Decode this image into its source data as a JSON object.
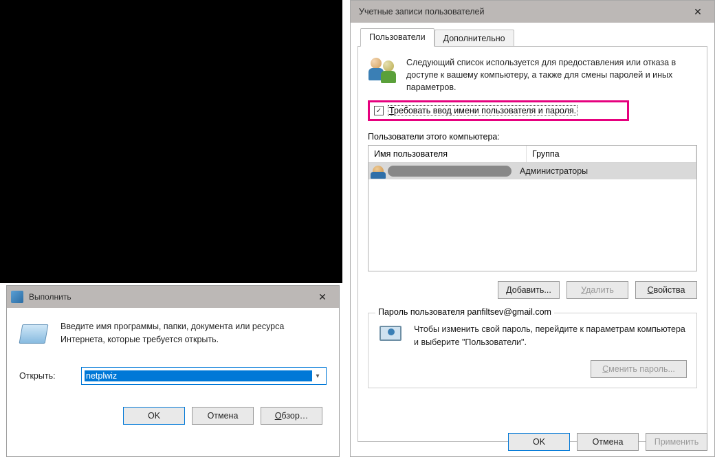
{
  "run": {
    "title": "Выполнить",
    "desc": "Введите имя программы, папки, документа или ресурса Интернета, которые требуется открыть.",
    "open_label": "Открыть:",
    "value": "netplwiz",
    "buttons": {
      "ok": "OK",
      "cancel": "Отмена",
      "browse": "Обзор…"
    }
  },
  "ua": {
    "title": "Учетные записи пользователей",
    "tabs": {
      "users": "Пользователи",
      "advanced": "Дополнительно"
    },
    "intro": "Следующий список используется для предоставления или отказа в доступе к вашему компьютеру, а также для смены паролей и иных параметров.",
    "require_label": "Требовать ввод имени пользователя и пароля.",
    "require_checked": true,
    "list_label": "Пользователи этого компьютера:",
    "columns": {
      "user": "Имя пользователя",
      "group": "Группа"
    },
    "rows": [
      {
        "group": "Администраторы"
      }
    ],
    "list_buttons": {
      "add": "Добавить...",
      "remove": "Удалить",
      "props": "Свойства"
    },
    "password_box_title": "Пароль пользователя panfiltsev@gmail.com",
    "password_text": "Чтобы изменить свой пароль, перейдите к параметрам компьютера и выберите \"Пользователи\".",
    "change_password": "Сменить пароль...",
    "bottom": {
      "ok": "OK",
      "cancel": "Отмена",
      "apply": "Применить"
    }
  }
}
